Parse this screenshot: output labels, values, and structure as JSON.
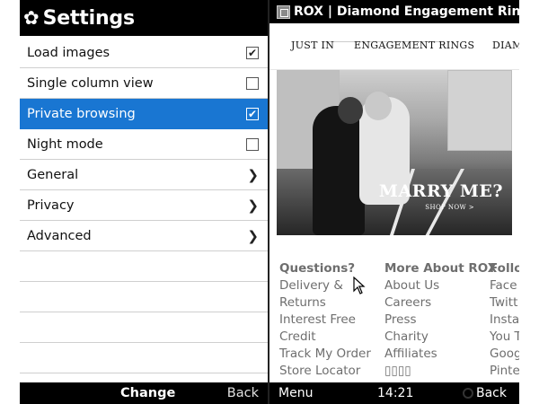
{
  "settings": {
    "title": "Settings",
    "header_icon": "gear-icon",
    "items": [
      {
        "label": "Load images",
        "control": "checkbox",
        "checked": true,
        "selected": false
      },
      {
        "label": "Single column view",
        "control": "checkbox",
        "checked": false,
        "selected": false
      },
      {
        "label": "Private browsing",
        "control": "checkbox",
        "checked": true,
        "selected": true
      },
      {
        "label": "Night mode",
        "control": "checkbox",
        "checked": false,
        "selected": false
      },
      {
        "label": "General",
        "control": "chevron"
      },
      {
        "label": "Privacy",
        "control": "chevron"
      },
      {
        "label": "Advanced",
        "control": "chevron"
      }
    ],
    "softkeys": {
      "center": "Change",
      "right": "Back"
    },
    "selected_color": "#1976d2"
  },
  "browser": {
    "tab_title": "ROX | Diamond Engagement Ring...",
    "nav": [
      "JUST IN",
      "ENGAGEMENT RINGS",
      "DIAM"
    ],
    "hero": {
      "headline": "MARRY ME?",
      "cta": "SHOP NOW >"
    },
    "footer": {
      "col1": {
        "heading": "Questions?",
        "links": [
          "Delivery &",
          "Returns",
          "Interest Free",
          "Credit",
          "Track My Order",
          "Store Locator"
        ]
      },
      "col2": {
        "heading": "More About ROX",
        "links": [
          "About Us",
          "Careers",
          "Press",
          "Charity",
          "Affiliates",
          "▯▯▯▯"
        ]
      },
      "col3": {
        "heading": "Follo",
        "links": [
          "Face",
          "Twitt",
          "Insta",
          "You T",
          "Goog",
          "Pinte"
        ]
      }
    },
    "softkeys": {
      "left": "Menu",
      "clock": "14:21",
      "right": "Back"
    }
  }
}
